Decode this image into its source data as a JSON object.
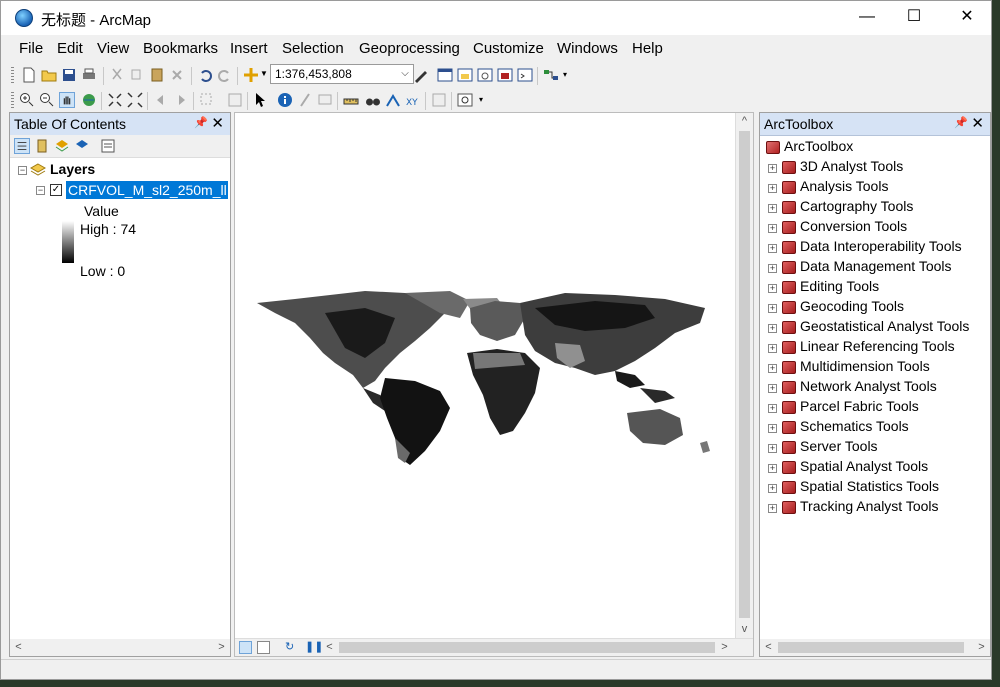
{
  "window": {
    "title": "无标题 - ArcMap",
    "minimize": "—",
    "maximize": "☐",
    "close": "✕"
  },
  "menu": [
    "File",
    "Edit",
    "View",
    "Bookmarks",
    "Insert",
    "Selection",
    "Geoprocessing",
    "Customize",
    "Windows",
    "Help"
  ],
  "toolbar": {
    "scale": "1:376,453,808"
  },
  "toc": {
    "title": "Table Of Contents",
    "layers_label": "Layers",
    "layer_name": "CRFVOL_M_sl2_250m_ll.",
    "legend_field": "Value",
    "high_label": "High : 74",
    "low_label": "Low : 0"
  },
  "toolbox": {
    "title": "ArcToolbox",
    "root": "ArcToolbox",
    "items": [
      "3D Analyst Tools",
      "Analysis Tools",
      "Cartography Tools",
      "Conversion Tools",
      "Data Interoperability Tools",
      "Data Management Tools",
      "Editing Tools",
      "Geocoding Tools",
      "Geostatistical Analyst Tools",
      "Linear Referencing Tools",
      "Multidimension Tools",
      "Network Analyst Tools",
      "Parcel Fabric Tools",
      "Schematics Tools",
      "Server Tools",
      "Spatial Analyst Tools",
      "Spatial Statistics Tools",
      "Tracking Analyst Tools"
    ]
  },
  "colors": {
    "selection": "#0078d7",
    "panel_header": "#d6e3f5",
    "toolbox_red": "#b22222"
  }
}
